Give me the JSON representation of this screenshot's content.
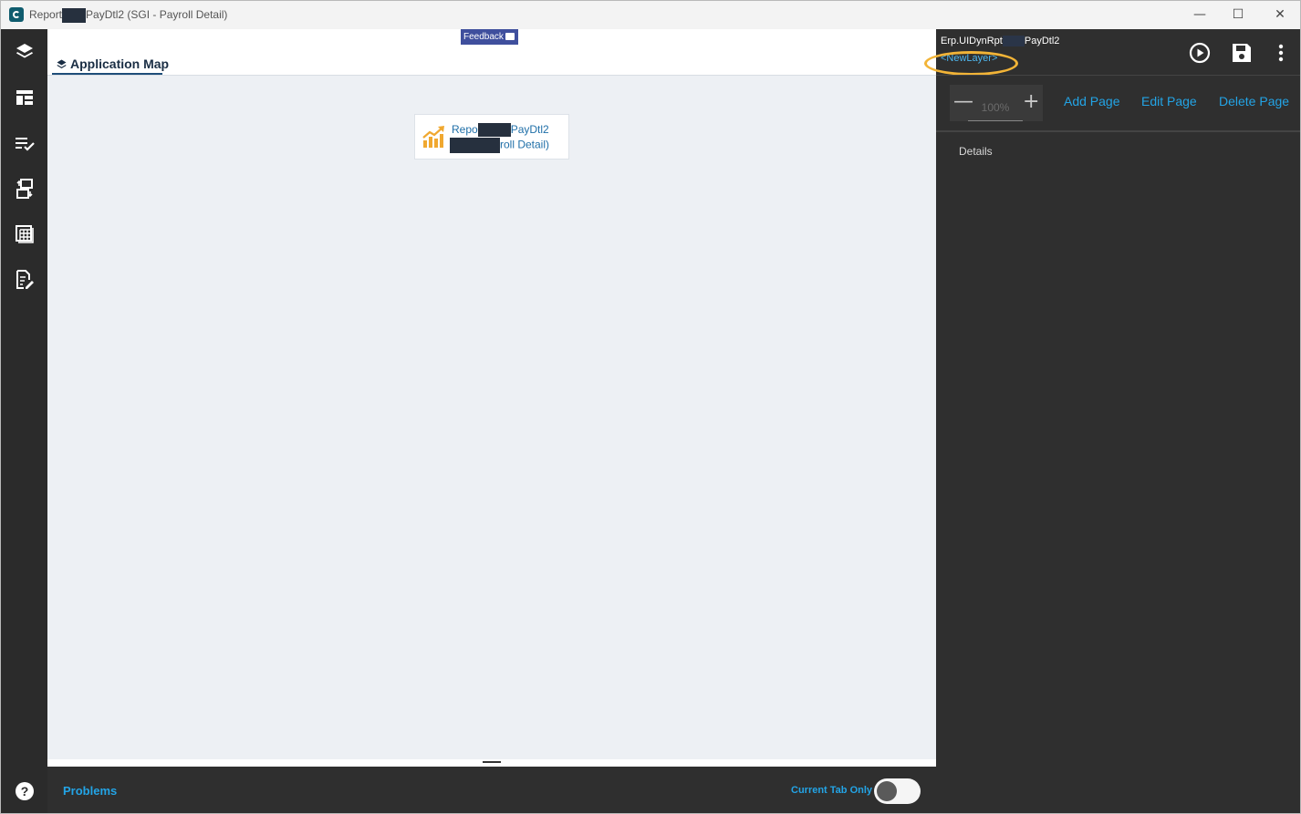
{
  "window": {
    "title_prefix": "Report",
    "title_suffix": "PayDtl2 (SGI - Payroll Detail)",
    "minimize_glyph": "—",
    "maximize_glyph": "☐",
    "close_glyph": "✕"
  },
  "rail": {
    "items": [
      "layers-icon",
      "layout-icon",
      "list-check-icon",
      "transfer-icon",
      "grid-table-icon",
      "edit-document-icon"
    ],
    "help_glyph": "?"
  },
  "main": {
    "feedback_label": "Feedback",
    "tab_label": "Application Map",
    "node": {
      "line1_prefix": "Repo",
      "line1_suffix": "PayDtl2",
      "line2_suffix": "roll Detail)"
    },
    "bottom": {
      "problems_label": "Problems",
      "current_tab_only_label": "Current Tab Only",
      "current_tab_only_on": false
    }
  },
  "right_panel": {
    "title_prefix": "Erp.UIDynRpt",
    "title_suffix": "PayDtl2",
    "layer_label": "<NewLayer>",
    "zoom": {
      "value": "100%",
      "minus_glyph": "—",
      "plus_glyph": "+"
    },
    "actions": {
      "add_page": "Add Page",
      "edit_page": "Edit Page",
      "delete_page": "Delete Page"
    },
    "details_label": "Details"
  },
  "colors": {
    "accent": "#23a4e6",
    "rail_bg": "#2b2b2b",
    "panel_bg": "#2f2f2f",
    "canvas_bg": "#edf0f4",
    "highlight": "#f2b437",
    "feedback_bg": "#3f4f9d"
  }
}
